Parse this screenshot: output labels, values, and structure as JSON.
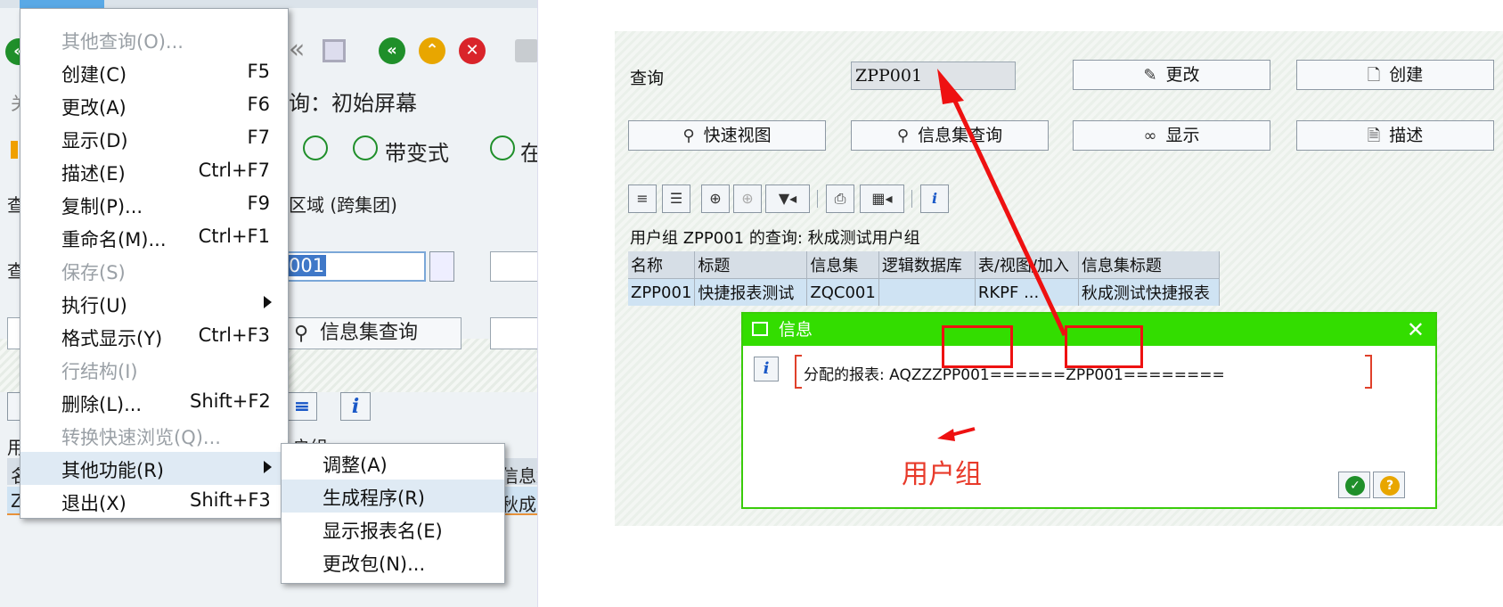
{
  "left": {
    "bg_title": "询：初始屏幕",
    "bg_zone": "区域 (跨集团)",
    "bg_field": "001",
    "bg_toolbar_item": "带变式",
    "bg_toolbar_item2": "在",
    "bg_button": "信息集查询",
    "bg_usergroup": "户组",
    "bg_col": "信息集",
    "bg_cell": "秋成测",
    "bg_left_chars": [
      "查",
      "查",
      "用",
      "名",
      "Z",
      "关"
    ],
    "menu": {
      "items": [
        {
          "label": "其他查询(O)...",
          "key": "",
          "disabled": true
        },
        {
          "label": "创建(C)",
          "key": "F5",
          "disabled": false
        },
        {
          "label": "更改(A)",
          "key": "F6",
          "disabled": false
        },
        {
          "label": "显示(D)",
          "key": "F7",
          "disabled": false
        },
        {
          "label": "描述(E)",
          "key": "Ctrl+F7",
          "disabled": false
        },
        {
          "label": "复制(P)...",
          "key": "F9",
          "disabled": false
        },
        {
          "label": "重命名(M)...",
          "key": "Ctrl+F1",
          "disabled": false
        },
        {
          "label": "保存(S)",
          "key": "",
          "disabled": true
        },
        {
          "label": "执行(U)",
          "key": "",
          "disabled": false
        },
        {
          "label": "格式显示(Y)",
          "key": "Ctrl+F3",
          "disabled": false
        },
        {
          "label": "行结构(I)",
          "key": "",
          "disabled": true
        },
        {
          "label": "删除(L)...",
          "key": "Shift+F2",
          "disabled": false
        },
        {
          "label": "转换快速浏览(Q)...",
          "key": "",
          "disabled": true
        },
        {
          "label": "其他功能(R)",
          "key": "",
          "disabled": false
        },
        {
          "label": "退出(X)",
          "key": "Shift+F3",
          "disabled": false
        }
      ]
    },
    "submenu": {
      "items": [
        {
          "label": "调整(A)"
        },
        {
          "label": "生成程序(R)"
        },
        {
          "label": "显示报表名(E)"
        },
        {
          "label": "更改包(N)..."
        }
      ]
    }
  },
  "right": {
    "query_label": "查询",
    "query_value": "ZPP001",
    "buttons": {
      "change": "更改",
      "create": "创建",
      "quick_view": "快速视图",
      "infoset_query": "信息集查询",
      "display": "显示",
      "describe": "描述"
    },
    "grid_title": "用户组 ZPP001 的查询: 秋成测试用户组",
    "table": {
      "headers": [
        "名称",
        "标题",
        "信息集",
        "逻辑数据库",
        "表/视图/加入",
        "信息集标题"
      ],
      "rows": [
        [
          "ZPP001",
          "快捷报表测试",
          "ZQC001",
          "",
          "RKPF ...",
          "秋成测试快捷报表"
        ]
      ]
    },
    "dialog": {
      "title": "信息",
      "message": "分配的报表: AQZZZPP001======ZPP001========",
      "close": "✕"
    },
    "annotation_label": "用户组"
  },
  "colors": {
    "dialog_header": "#33dd00",
    "annotation_red": "#ee1111",
    "selected_row": "#cfe3f3"
  }
}
